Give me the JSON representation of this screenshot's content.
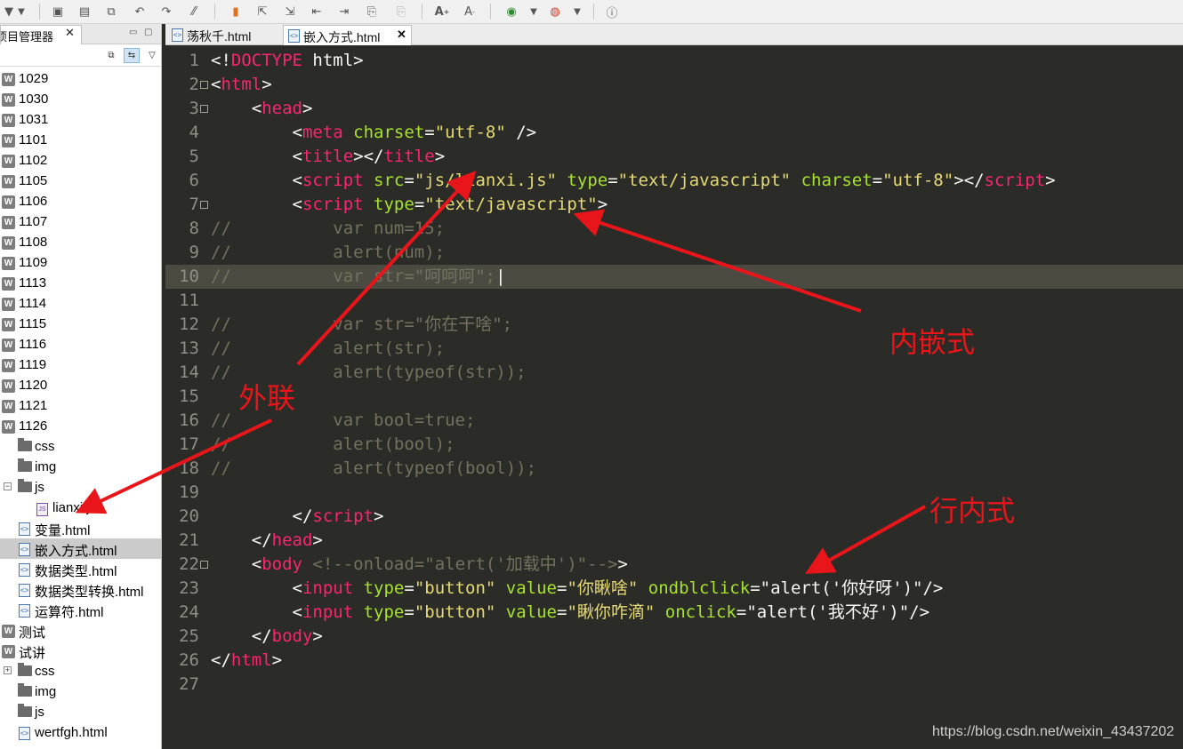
{
  "panel": {
    "title": "项目管理器",
    "close": "✕",
    "min": "▭",
    "max": "▢",
    "dropdown": "▽"
  },
  "tree": [
    {
      "label": "1029",
      "icon": "w",
      "indent": 0
    },
    {
      "label": "1030",
      "icon": "w",
      "indent": 0
    },
    {
      "label": "1031",
      "icon": "w",
      "indent": 0
    },
    {
      "label": "1101",
      "icon": "w",
      "indent": 0
    },
    {
      "label": "1102",
      "icon": "w",
      "indent": 0
    },
    {
      "label": "1105",
      "icon": "w",
      "indent": 0
    },
    {
      "label": "1106",
      "icon": "w",
      "indent": 0
    },
    {
      "label": "1107",
      "icon": "w",
      "indent": 0
    },
    {
      "label": "1108",
      "icon": "w",
      "indent": 0
    },
    {
      "label": "1109",
      "icon": "w",
      "indent": 0
    },
    {
      "label": "1113",
      "icon": "w",
      "indent": 0
    },
    {
      "label": "1114",
      "icon": "w",
      "indent": 0
    },
    {
      "label": "1115",
      "icon": "w",
      "indent": 0
    },
    {
      "label": "1116",
      "icon": "w",
      "indent": 0
    },
    {
      "label": "1119",
      "icon": "w",
      "indent": 0
    },
    {
      "label": "1120",
      "icon": "w",
      "indent": 0
    },
    {
      "label": "1121",
      "icon": "w",
      "indent": 0
    },
    {
      "label": "1126",
      "icon": "w",
      "indent": 0
    },
    {
      "label": "css",
      "icon": "folder",
      "indent": 1
    },
    {
      "label": "img",
      "icon": "folder",
      "indent": 1
    },
    {
      "label": "js",
      "icon": "folder",
      "indent": 1,
      "expander": "−"
    },
    {
      "label": "lianxi.js",
      "icon": "js",
      "indent": 2
    },
    {
      "label": "变量.html",
      "icon": "html",
      "indent": 1
    },
    {
      "label": "嵌入方式.html",
      "icon": "html",
      "indent": 1,
      "selected": true
    },
    {
      "label": "数据类型.html",
      "icon": "html",
      "indent": 1
    },
    {
      "label": "数据类型转换.html",
      "icon": "html",
      "indent": 1
    },
    {
      "label": "运算符.html",
      "icon": "html",
      "indent": 1
    },
    {
      "label": "测试",
      "icon": "w",
      "indent": 0
    },
    {
      "label": "试讲",
      "icon": "w",
      "indent": 0
    },
    {
      "label": "css",
      "icon": "folder",
      "indent": 1,
      "expander": "+"
    },
    {
      "label": "img",
      "icon": "folder",
      "indent": 1
    },
    {
      "label": "js",
      "icon": "folder",
      "indent": 1
    },
    {
      "label": "wertfgh.html",
      "icon": "html",
      "indent": 1
    }
  ],
  "editor_tabs": [
    {
      "label": "荡秋千.html",
      "active": false
    },
    {
      "label": "嵌入方式.html",
      "active": true
    }
  ],
  "tab_close": "✕",
  "code_lines": [
    [
      [
        "p",
        "<!"
      ],
      [
        "t",
        "DOCTYPE"
      ],
      [
        "p",
        " html>"
      ]
    ],
    [
      [
        "p",
        "<"
      ],
      [
        "t",
        "html"
      ],
      [
        "p",
        ">"
      ]
    ],
    [
      [
        "p",
        "    <"
      ],
      [
        "t",
        "head"
      ],
      [
        "p",
        ">"
      ]
    ],
    [
      [
        "p",
        "        <"
      ],
      [
        "t",
        "meta"
      ],
      [
        "p",
        " "
      ],
      [
        "a",
        "charset"
      ],
      [
        "p",
        "="
      ],
      [
        "s",
        "\"utf-8\""
      ],
      [
        "p",
        " />"
      ]
    ],
    [
      [
        "p",
        "        <"
      ],
      [
        "t",
        "title"
      ],
      [
        "p",
        "></"
      ],
      [
        "t",
        "title"
      ],
      [
        "p",
        ">"
      ]
    ],
    [
      [
        "p",
        "        <"
      ],
      [
        "t",
        "script"
      ],
      [
        "p",
        " "
      ],
      [
        "a",
        "src"
      ],
      [
        "p",
        "="
      ],
      [
        "s",
        "\"js/lianxi.js\""
      ],
      [
        "p",
        " "
      ],
      [
        "a",
        "type"
      ],
      [
        "p",
        "="
      ],
      [
        "s",
        "\"text/javascript\""
      ],
      [
        "p",
        " "
      ],
      [
        "a",
        "charset"
      ],
      [
        "p",
        "="
      ],
      [
        "s",
        "\"utf-8\""
      ],
      [
        "p",
        "></"
      ],
      [
        "t",
        "script"
      ],
      [
        "p",
        ">"
      ]
    ],
    [
      [
        "p",
        "        <"
      ],
      [
        "t",
        "script"
      ],
      [
        "p",
        " "
      ],
      [
        "a",
        "type"
      ],
      [
        "p",
        "="
      ],
      [
        "s",
        "\"text/javascript\""
      ],
      [
        "p",
        ">"
      ]
    ],
    [
      [
        "c",
        "//          var num=15;"
      ]
    ],
    [
      [
        "c",
        "//          alert(num);"
      ]
    ],
    [
      [
        "c",
        "//          var str=\"呵呵呵\";"
      ],
      [
        "p",
        "|"
      ]
    ],
    [],
    [
      [
        "c",
        "//          var str=\"你在干啥\";"
      ]
    ],
    [
      [
        "c",
        "//          alert(str);"
      ]
    ],
    [
      [
        "c",
        "//          alert(typeof(str));"
      ]
    ],
    [],
    [
      [
        "c",
        "//          var bool=true;"
      ]
    ],
    [
      [
        "c",
        "//          alert(bool);"
      ]
    ],
    [
      [
        "c",
        "//          alert(typeof(bool));"
      ]
    ],
    [],
    [
      [
        "p",
        "        </"
      ],
      [
        "t",
        "script"
      ],
      [
        "p",
        ">"
      ]
    ],
    [
      [
        "p",
        "    </"
      ],
      [
        "t",
        "head"
      ],
      [
        "p",
        ">"
      ]
    ],
    [
      [
        "p",
        "    <"
      ],
      [
        "t",
        "body"
      ],
      [
        "p",
        " "
      ],
      [
        "c",
        "<!--onload=\"alert('加载中')\"-->"
      ],
      [
        "p",
        ">"
      ]
    ],
    [
      [
        "p",
        "        <"
      ],
      [
        "t",
        "input"
      ],
      [
        "p",
        " "
      ],
      [
        "a",
        "type"
      ],
      [
        "p",
        "="
      ],
      [
        "s",
        "\"button\""
      ],
      [
        "p",
        " "
      ],
      [
        "a",
        "value"
      ],
      [
        "p",
        "="
      ],
      [
        "s",
        "\"你瞅啥\""
      ],
      [
        "p",
        " "
      ],
      [
        "a",
        "ondblclick"
      ],
      [
        "p",
        "=\"alert('你好呀')\"/>"
      ]
    ],
    [
      [
        "p",
        "        <"
      ],
      [
        "t",
        "input"
      ],
      [
        "p",
        " "
      ],
      [
        "a",
        "type"
      ],
      [
        "p",
        "="
      ],
      [
        "s",
        "\"button\""
      ],
      [
        "p",
        " "
      ],
      [
        "a",
        "value"
      ],
      [
        "p",
        "="
      ],
      [
        "s",
        "\"瞅你咋滴\""
      ],
      [
        "p",
        " "
      ],
      [
        "a",
        "onclick"
      ],
      [
        "p",
        "=\"alert('我不好')\"/>"
      ]
    ],
    [
      [
        "p",
        "    </"
      ],
      [
        "t",
        "body"
      ],
      [
        "p",
        ">"
      ]
    ],
    [
      [
        "p",
        "</"
      ],
      [
        "t",
        "html"
      ],
      [
        "p",
        ">"
      ]
    ],
    []
  ],
  "fold_lines": [
    2,
    3,
    7,
    22
  ],
  "highlight_line": 10,
  "annotations": {
    "external": "外联",
    "embedded": "内嵌式",
    "inline": "行内式",
    "color": "#e8161b"
  },
  "watermark": "https://blog.csdn.net/weixin_43437202"
}
